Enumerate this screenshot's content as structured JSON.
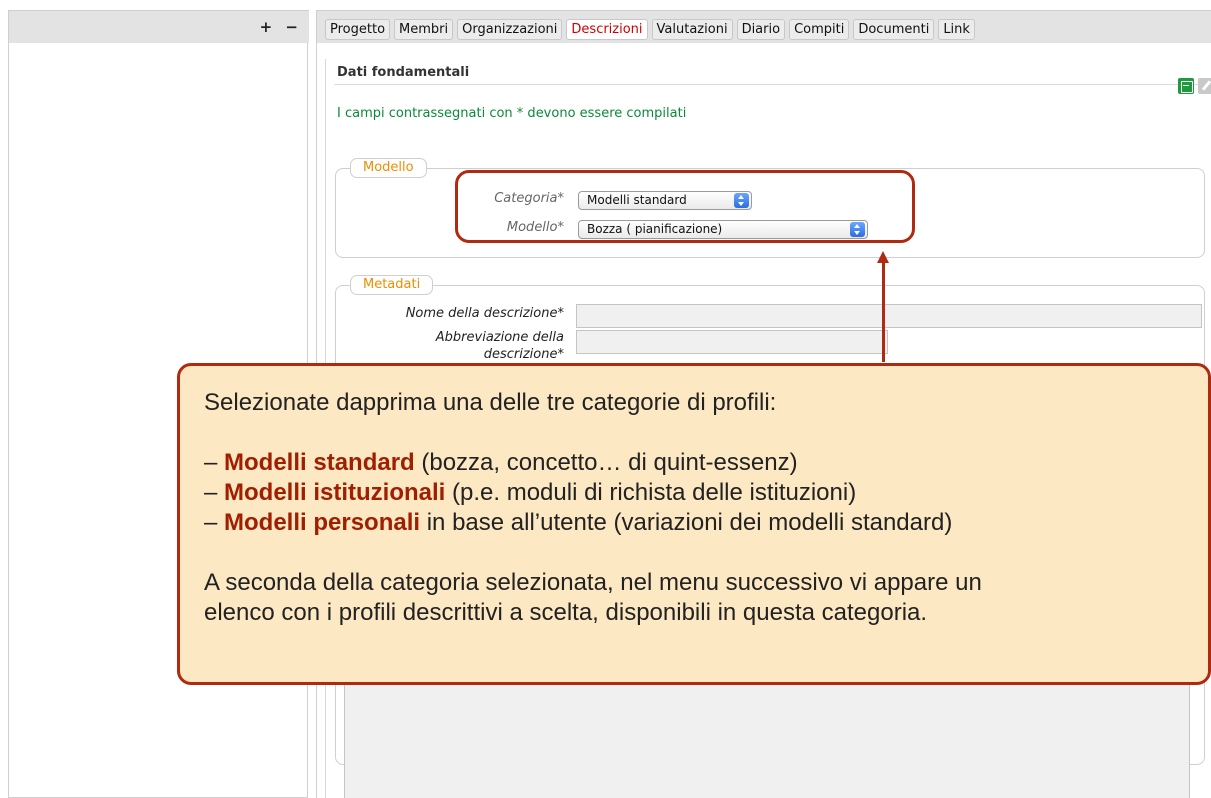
{
  "left_panel": {
    "plus_label": "+",
    "minus_label": "−"
  },
  "tabs": [
    {
      "label": "Progetto"
    },
    {
      "label": "Membri"
    },
    {
      "label": "Organizzazioni"
    },
    {
      "label": "Descrizioni",
      "active": true
    },
    {
      "label": "Valutazioni"
    },
    {
      "label": "Diario"
    },
    {
      "label": "Compiti"
    },
    {
      "label": "Documenti"
    },
    {
      "label": "Link"
    }
  ],
  "content": {
    "section_title": "Dati fondamentali",
    "required_note": "I campi contrassegnati con * devono essere compilati",
    "icons": {
      "save": "save-icon",
      "edit": "pencil-icon"
    },
    "modello": {
      "legend": "Modello",
      "categoria_label": "Categoria*",
      "categoria_value": "Modelli standard",
      "modello_label": "Modello*",
      "modello_value": "Bozza ( pianificazione)"
    },
    "metadati": {
      "legend": "Metadati",
      "nome_label": "Nome della descrizione*",
      "nome_value": "",
      "abbrev_label_1": "Abbreviazione della",
      "abbrev_label_2": "descrizione*",
      "abbrev_value": ""
    }
  },
  "callout": {
    "intro": "Selezionate dapprima una delle tre categorie di profili:",
    "items": [
      {
        "prefix": "– ",
        "bold": "Modelli standard",
        "rest": " (bozza, concetto… di quint-essenz)"
      },
      {
        "prefix": "– ",
        "bold": "Modelli istituzionali",
        "rest": " (p.e. moduli di richista delle istituzioni)"
      },
      {
        "prefix": "– ",
        "bold": "Modelli personali",
        "rest": " in base all’utente (variazioni dei modelli standard)"
      }
    ],
    "outro_1": "A seconda della categoria selezionata, nel menu successivo vi appare un",
    "outro_2": "elenco con i profili descrittivi a scelta, disponibili in questa categoria."
  },
  "colors": {
    "accent_red": "#b02a10",
    "active_tab": "#d10000",
    "legend_orange": "#f08c00",
    "note_green": "#0a8a3a",
    "callout_bg": "#fde8c4"
  }
}
